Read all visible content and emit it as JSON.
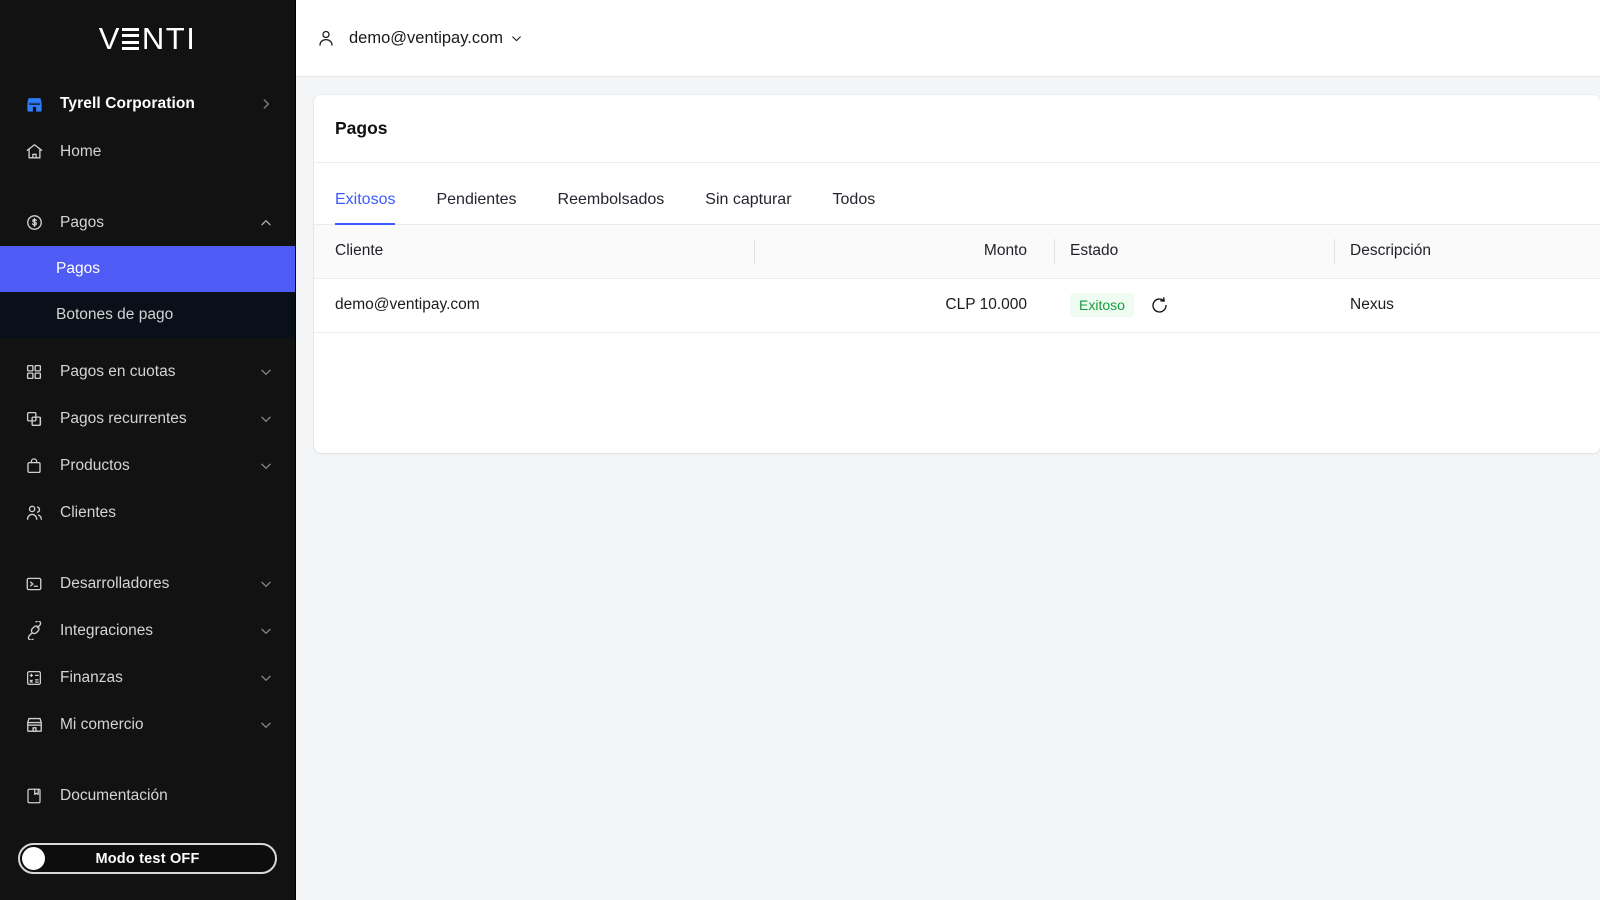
{
  "brand": {
    "logo_text": "VENTI",
    "logo_parts": {
      "v": "V",
      "e": "E",
      "nti": "NTI"
    }
  },
  "colors": {
    "sidebar_bg": "#121212",
    "submenu_bg": "#0a1019",
    "accent_blue": "#4f5bf5",
    "tab_active": "#3d5afe",
    "badge_bg": "#eefcf1",
    "badge_text": "#189c3d",
    "page_bg": "#f4f5f7",
    "org_icon_blue": "#2f7cf6"
  },
  "sidebar": {
    "org": {
      "label": "Tyrell Corporation",
      "icon": "store-icon",
      "chevron": "chevron-right-icon"
    },
    "items": [
      {
        "label": "Home",
        "icon": "home-icon",
        "chevron": null
      },
      {
        "label": "Pagos",
        "icon": "dollar-circle-icon",
        "chevron": "chevron-up-icon",
        "expanded": true
      },
      {
        "label": "Pagos en cuotas",
        "icon": "grid-icon",
        "chevron": "chevron-down-icon"
      },
      {
        "label": "Pagos recurrentes",
        "icon": "copy-icon",
        "chevron": "chevron-down-icon"
      },
      {
        "label": "Productos",
        "icon": "bag-icon",
        "chevron": "chevron-down-icon"
      },
      {
        "label": "Clientes",
        "icon": "users-icon",
        "chevron": null
      },
      {
        "label": "Desarrolladores",
        "icon": "terminal-icon",
        "chevron": "chevron-down-icon"
      },
      {
        "label": "Integraciones",
        "icon": "plug-icon",
        "chevron": "chevron-down-icon"
      },
      {
        "label": "Finanzas",
        "icon": "calculator-icon",
        "chevron": "chevron-down-icon"
      },
      {
        "label": "Mi comercio",
        "icon": "storefront-icon",
        "chevron": "chevron-down-icon"
      },
      {
        "label": "Documentación",
        "icon": "book-icon",
        "chevron": null
      }
    ],
    "submenu": [
      {
        "label": "Pagos",
        "active": true
      },
      {
        "label": "Botones de pago",
        "active": false
      }
    ],
    "test_mode": {
      "label": "Modo test OFF",
      "state": "off"
    }
  },
  "topbar": {
    "user_email": "demo@ventipay.com",
    "person_icon": "person-icon",
    "chevron_icon": "chevron-down-icon"
  },
  "page": {
    "title": "Pagos",
    "tabs": [
      {
        "label": "Exitosos",
        "active": true
      },
      {
        "label": "Pendientes",
        "active": false
      },
      {
        "label": "Reembolsados",
        "active": false
      },
      {
        "label": "Sin capturar",
        "active": false
      },
      {
        "label": "Todos",
        "active": false
      }
    ],
    "table": {
      "columns": [
        "Cliente",
        "Monto",
        "Estado",
        "Descripción"
      ],
      "rows": [
        {
          "cliente": "demo@ventipay.com",
          "monto": "CLP 10.000",
          "estado": "Exitoso",
          "estado_icon": "recurring-icon",
          "descripcion": "Nexus"
        }
      ]
    }
  }
}
